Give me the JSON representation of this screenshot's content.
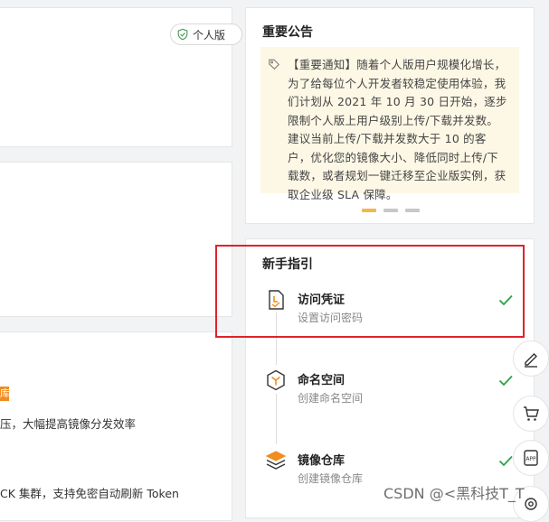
{
  "edition_badge": {
    "label": "个人版",
    "icon": "shield-check-icon"
  },
  "left_panel": {
    "tag_label": "库",
    "line_1": "压，大幅提高镜像分发效率",
    "line_2": "CK 集群，支持免密自动刷新 Token"
  },
  "announcement": {
    "title": "重要公告",
    "icon": "tag-icon",
    "text": "【重要通知】随着个人版用户规模化增长，为了给每位个人开发者较稳定使用体验，我们计划从 2021 年 10 月 30 日开始，逐步限制个人版上用户级别上传/下载并发数。建议当前上传/下载并发数大于 10 的客户，优化您的镜像大小、降低同时上传/下载数，或者规划一键迁移至企业版实例，获取企业级 SLA 保障。",
    "carousel": {
      "count": 3,
      "active_index": 0
    }
  },
  "guide": {
    "title": "新手指引",
    "steps": [
      {
        "title": "访问凭证",
        "subtitle": "设置访问密码",
        "icon": "credential-icon",
        "completed": true
      },
      {
        "title": "命名空间",
        "subtitle": "创建命名空间",
        "icon": "namespace-icon",
        "completed": true
      },
      {
        "title": "镜像仓库",
        "subtitle": "创建镜像仓库",
        "icon": "repository-icon",
        "completed": true
      }
    ]
  },
  "floating_toolbar": [
    "edit-icon",
    "cart-icon",
    "app-icon",
    "settings-icon"
  ],
  "watermark": "CSDN @<黑科技T_T",
  "colors": {
    "accent_orange": "#f08c20",
    "success_green": "#2ba245",
    "highlight_red": "#e0222b",
    "notice_bg": "#fdf8e6",
    "carousel_active": "#f2b84b"
  }
}
